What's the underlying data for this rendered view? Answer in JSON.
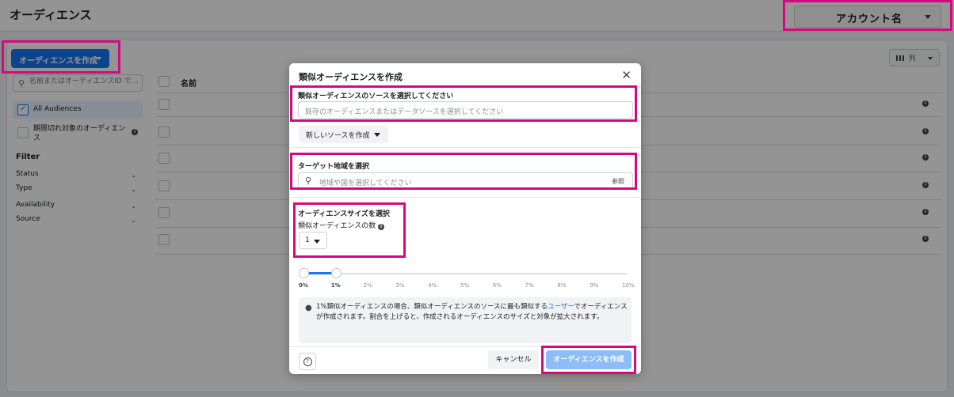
{
  "page": {
    "title": "オーディエンス",
    "account_label": "アカウント名",
    "create_button": "オーディエンスを作成",
    "search_placeholder": "名前またはオーディエンスID で…",
    "columns_button": "列",
    "audience_items": [
      {
        "label": "All Audiences",
        "checked": true
      },
      {
        "label": "期限切れ対象のオーディエンス",
        "checked": false
      }
    ],
    "filter_title": "Filter",
    "filters": [
      "Status",
      "Type",
      "Availability",
      "Source"
    ],
    "table_header_name": "名前"
  },
  "modal": {
    "title": "類似オーディエンスを作成",
    "source_section": {
      "label": "類似オーディエンスのソースを選択してください",
      "placeholder": "既存のオーディエンスまたはデータソースを選択してください",
      "new_source_button": "新しいソースを作成"
    },
    "location_section": {
      "label": "ターゲット地域を選択",
      "placeholder": "地域や国を選択してください",
      "browse_link": "参照"
    },
    "size_section": {
      "label": "オーディエンスサイズを選択",
      "count_label": "類似オーディエンスの数",
      "count_value": "1"
    },
    "slider": {
      "ticks": [
        "0%",
        "1%",
        "2%",
        "3%",
        "4%",
        "5%",
        "6%",
        "7%",
        "8%",
        "9%",
        "10%"
      ],
      "selected_range": [
        0,
        1
      ]
    },
    "tip": {
      "text_before": "1%類似オーディエンスの場合、類似オーディエンスのソースに最も類似する",
      "link": "ユーザー",
      "text_after": "でオーディエンスが作成されます。割合を上げると、作成されるオーディエンスのサイズと対象が拡大されます。"
    },
    "cancel_button": "キャンセル",
    "submit_button": "オーディエンスを作成"
  },
  "colors": {
    "accent": "#1877f2",
    "highlight": "#d6087f",
    "submit_disabled": "#8cbdf9"
  }
}
